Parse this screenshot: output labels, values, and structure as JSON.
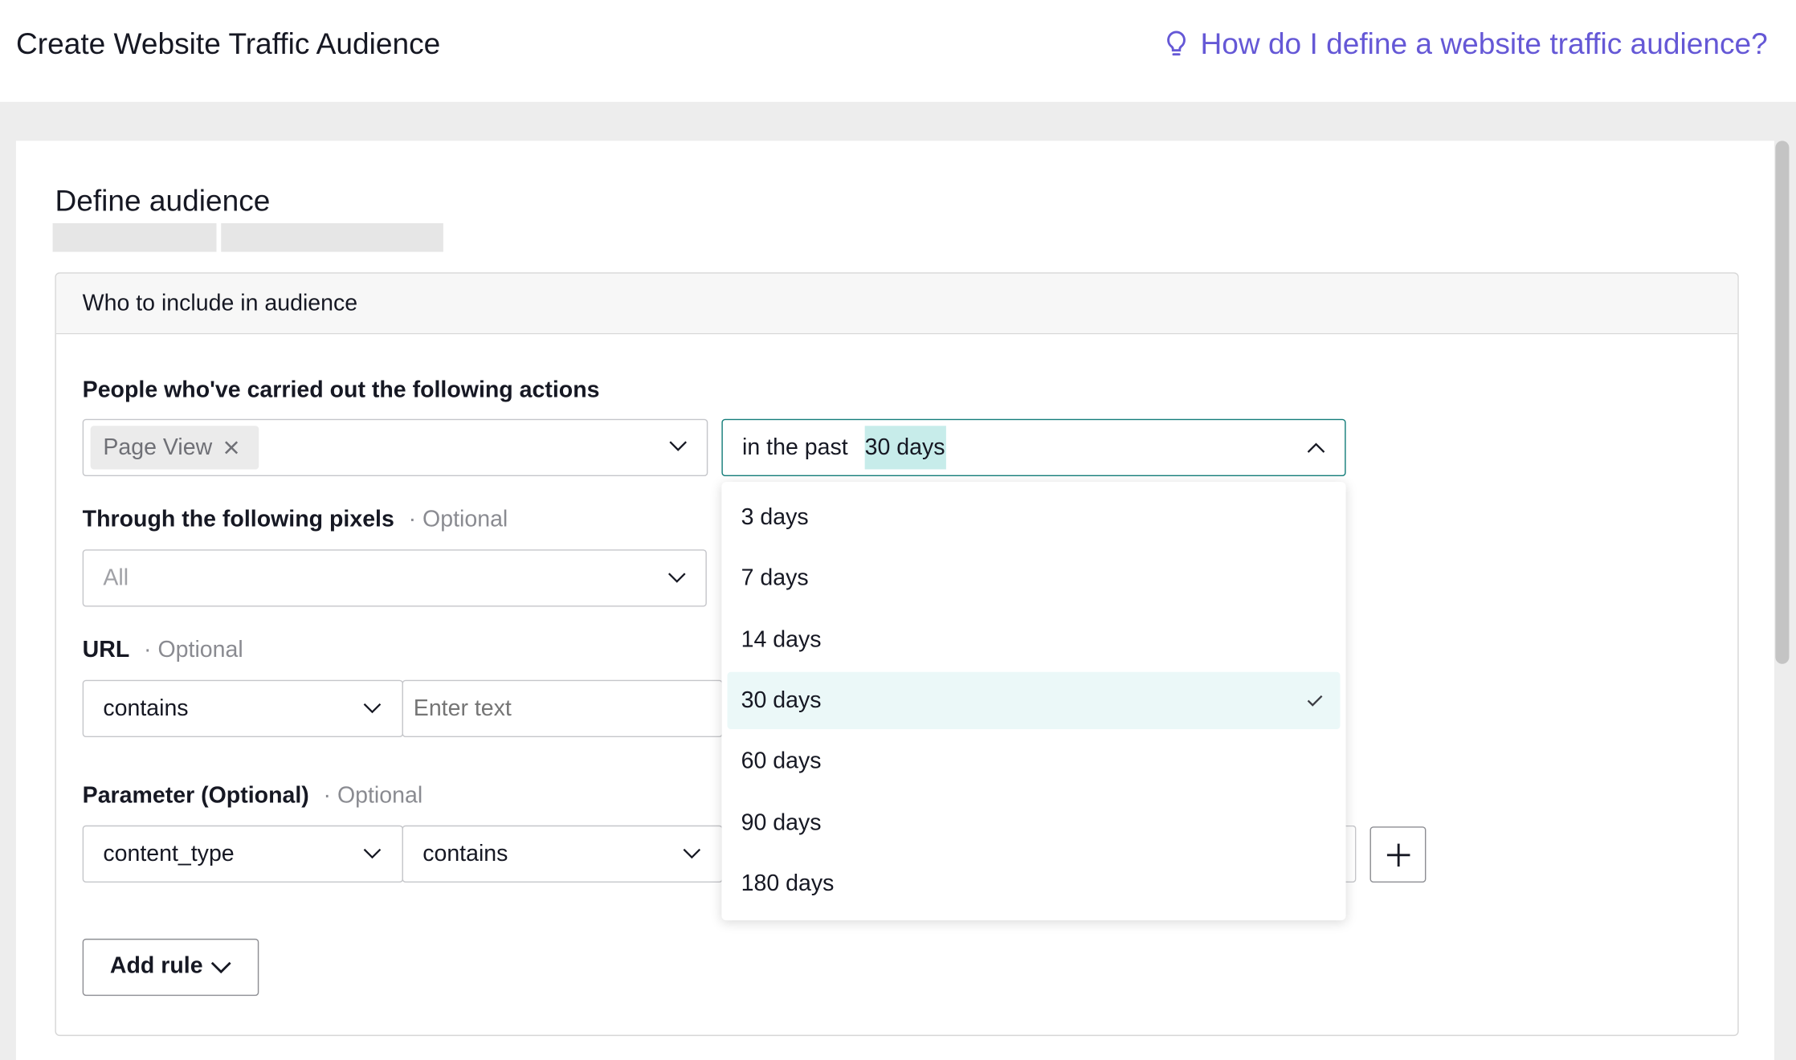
{
  "header": {
    "title": "Create Website Traffic Audience",
    "help_link": "How do I define a website traffic audience?"
  },
  "section": {
    "title": "Define audience"
  },
  "panel": {
    "title": "Who to include in audience",
    "actions_label": "People who've carried out the following actions",
    "action_tag": "Page View",
    "time_prefix": "in the past",
    "time_value": "30 days",
    "time_options": [
      {
        "label": "3 days",
        "selected": false
      },
      {
        "label": "7 days",
        "selected": false
      },
      {
        "label": "14 days",
        "selected": false
      },
      {
        "label": "30 days",
        "selected": true
      },
      {
        "label": "60 days",
        "selected": false
      },
      {
        "label": "90 days",
        "selected": false
      },
      {
        "label": "180 days",
        "selected": false
      }
    ],
    "pixels_label": "Through the following pixels",
    "optional": "· Optional",
    "pixels_value": "All",
    "url_label": "URL",
    "url_operator": "contains",
    "url_placeholder": "Enter text",
    "param_label": "Parameter (Optional)",
    "param_key": "content_type",
    "param_operator": "contains",
    "add_rule": "Add rule"
  },
  "colors": {
    "accent": "#137d7a",
    "link": "#6558d6",
    "highlight": "#c7ecea",
    "selected_row": "#ebf8f8"
  },
  "icons": [
    "lightbulb-icon",
    "close-icon",
    "chevron-down-icon",
    "chevron-up-icon",
    "check-icon",
    "plus-icon"
  ]
}
